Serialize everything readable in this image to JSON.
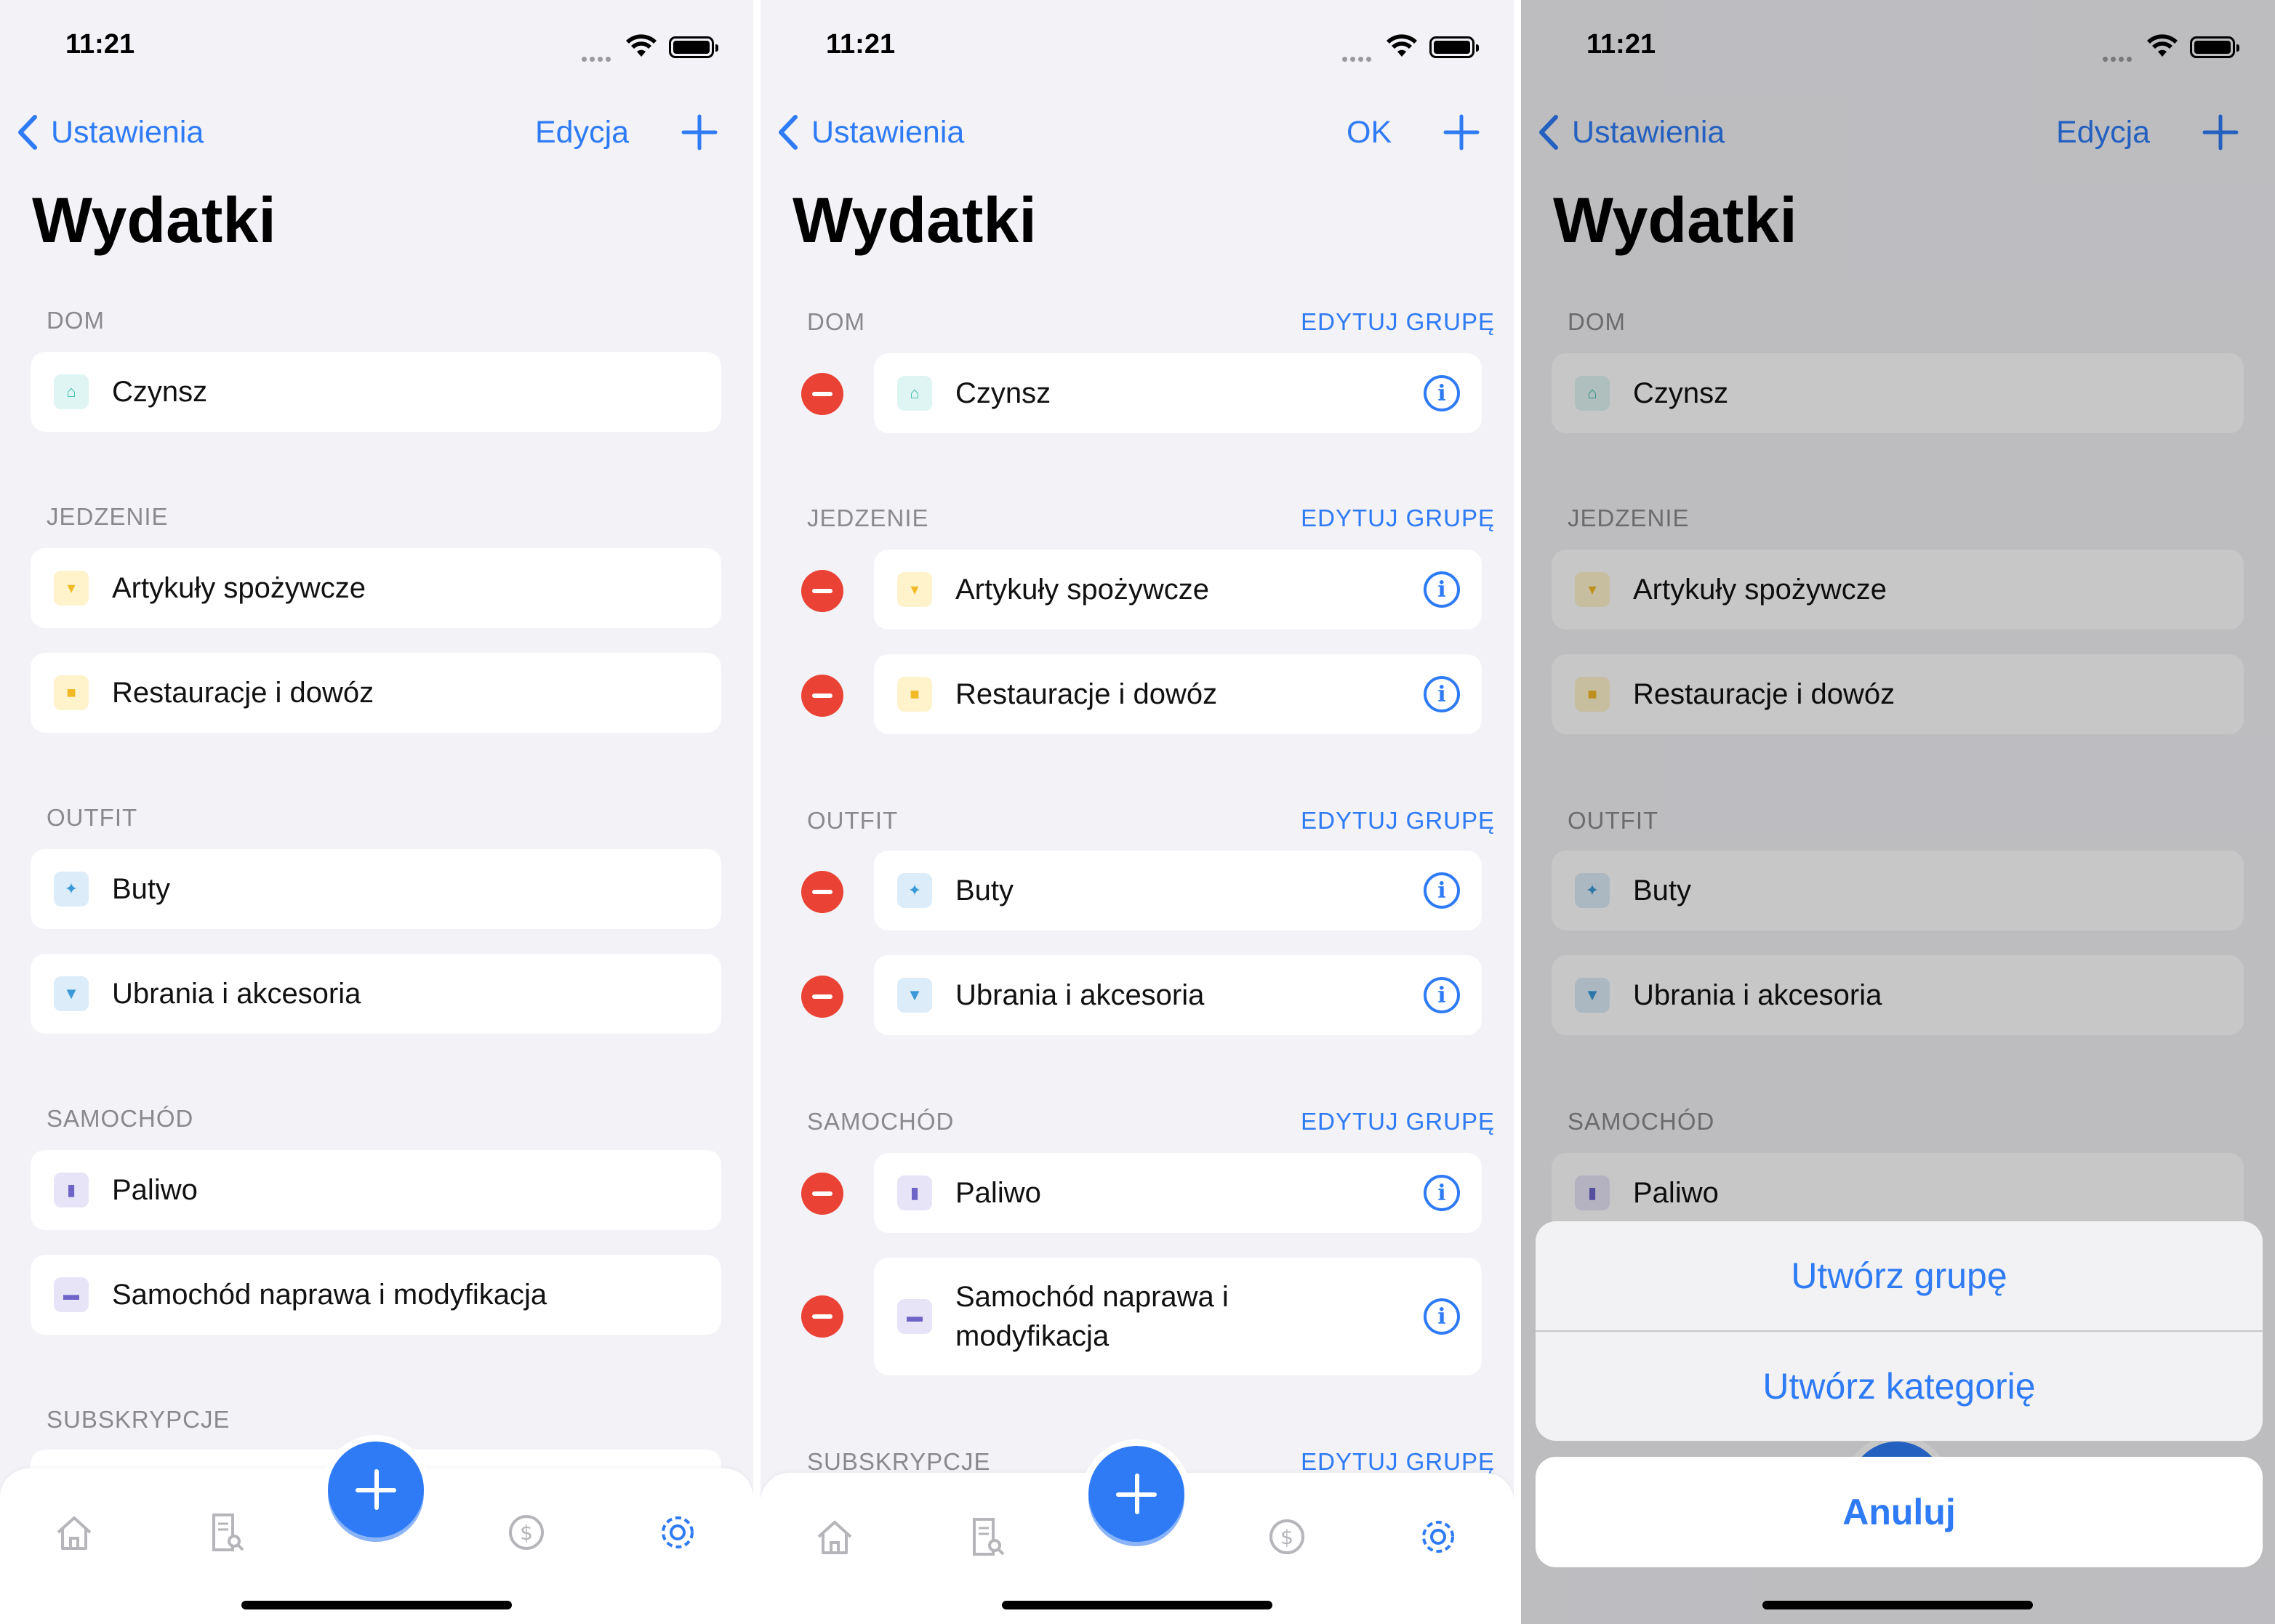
{
  "status": {
    "time": "11:21"
  },
  "nav": {
    "back_label": "Ustawienia",
    "edit_label": "Edycja",
    "done_label": "OK"
  },
  "page": {
    "title": "Wydatki"
  },
  "edit_group_label": "EDYTUJ GRUPĘ",
  "sections": {
    "dom": {
      "title": "DOM",
      "items": [
        "Czynsz"
      ]
    },
    "jedzenie": {
      "title": "JEDZENIE",
      "items": [
        "Artykuły spożywcze",
        "Restauracje i dowóz"
      ]
    },
    "outfit": {
      "title": "OUTFIT",
      "items": [
        "Buty",
        "Ubrania i akcesoria"
      ]
    },
    "samochod": {
      "title": "SAMOCHÓD",
      "items": [
        "Paliwo",
        "Samochód naprawa i modyfikacja"
      ],
      "items_wrapped": [
        "Paliwo",
        "Samochód naprawa i\nmodyfikacja"
      ]
    },
    "subskrypcje": {
      "title": "SUBSKRYPCJE"
    }
  },
  "icons": {
    "czynsz": "house-icon",
    "artykuly": "cart-icon",
    "restauracje": "food-icon",
    "buty": "walking-icon",
    "ubrania": "tshirt-icon",
    "paliwo": "fuel-icon",
    "samochod": "car-icon"
  },
  "tabbar": [
    "home-icon",
    "receipt-search-icon",
    "add-button",
    "dollar-icon",
    "gear-icon"
  ],
  "action_sheet": {
    "create_group": "Utwórz grupę",
    "create_category": "Utwórz kategorię",
    "cancel": "Anuluj"
  },
  "colors": {
    "accent": "#2f7bf5",
    "delete": "#ea4335",
    "background": "#f2f2f7"
  }
}
